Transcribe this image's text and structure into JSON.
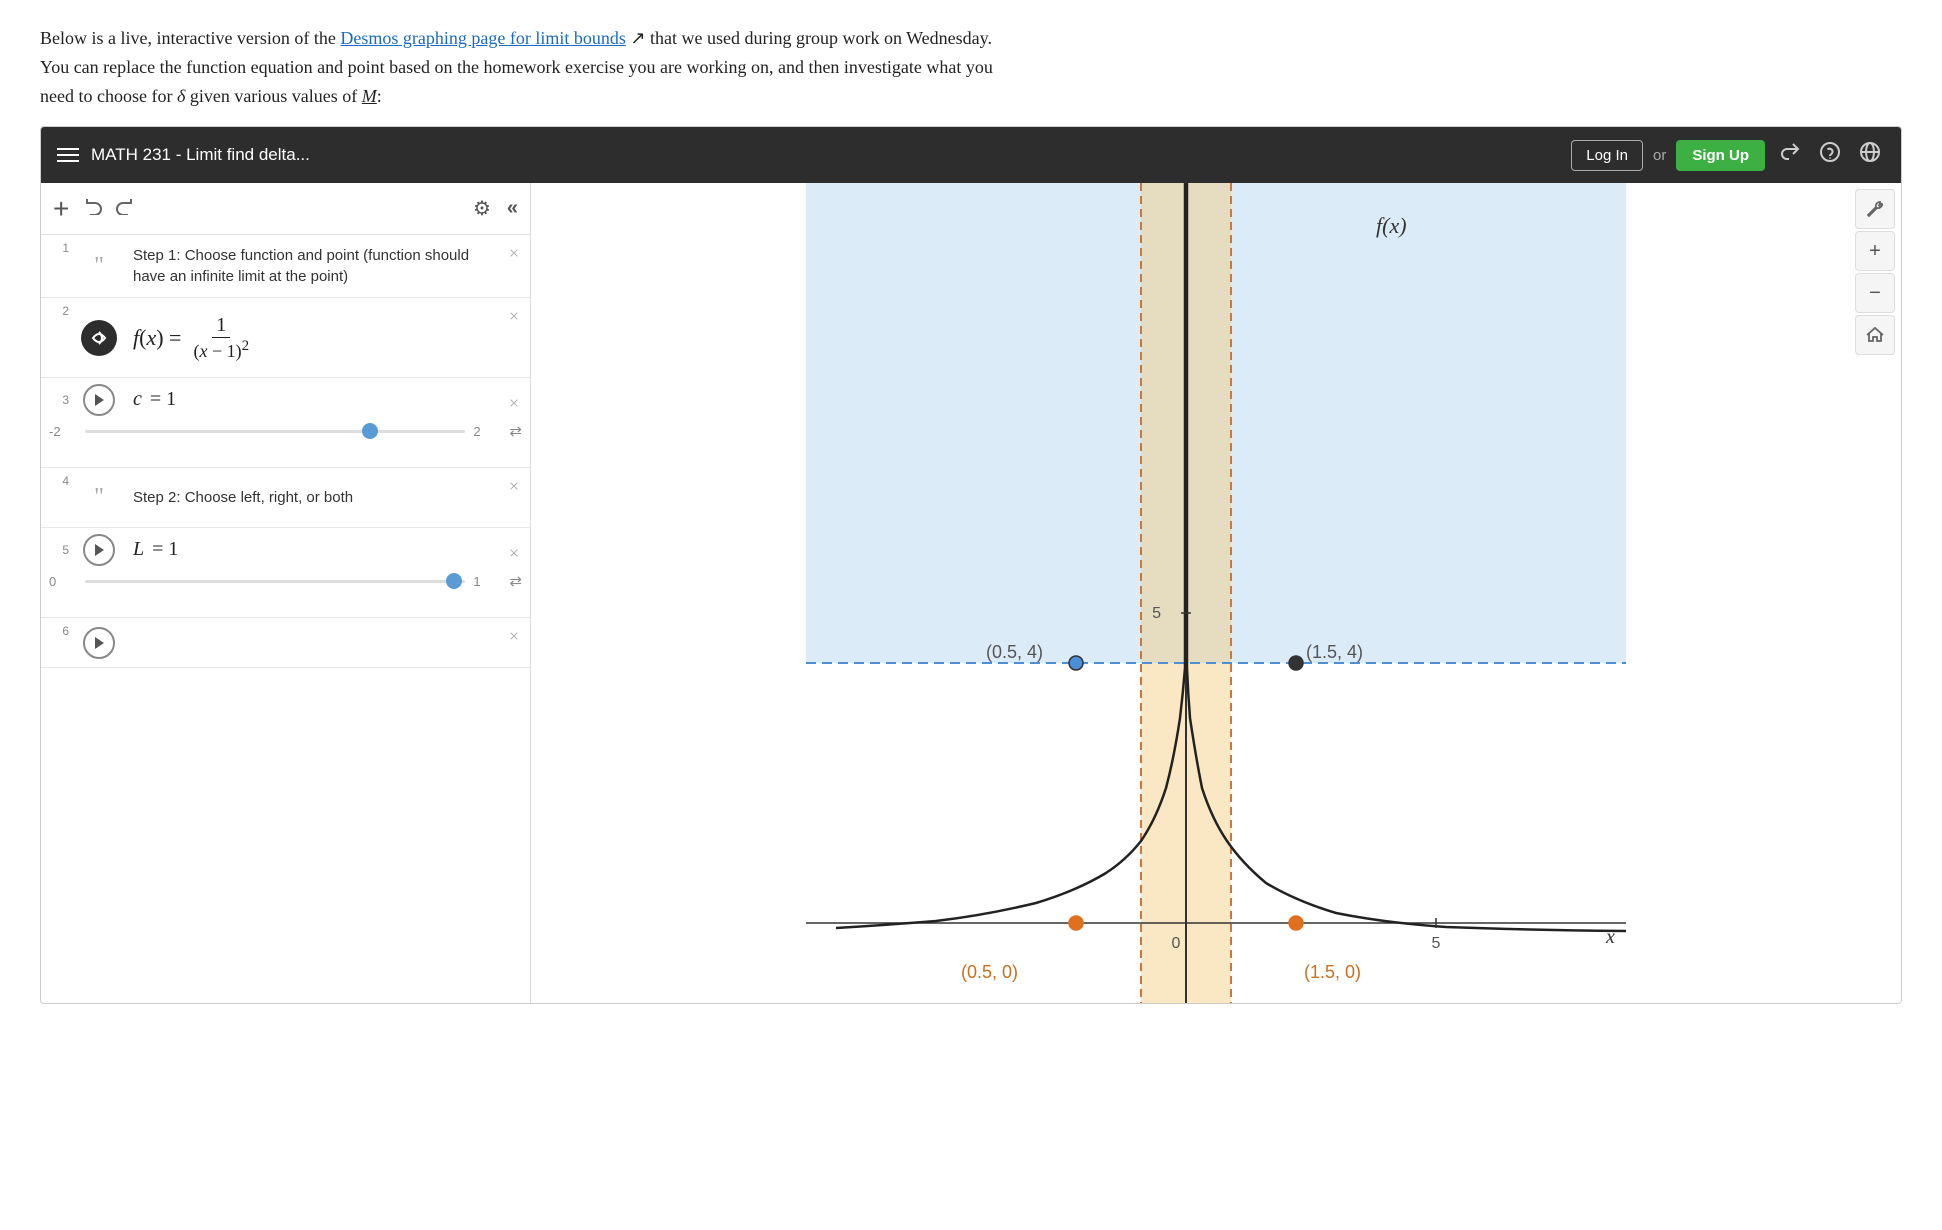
{
  "intro": {
    "line1_start": "Below is a live, interactive version of the ",
    "link_text": "Desmos graphing page for limit bounds",
    "line1_end": " that we used during group work on Wednesday.",
    "line2": "You can replace the function equation and point based on the homework exercise you are working on, and then investigate what you",
    "line3_start": "need to choose for ",
    "delta": "δ",
    "line3_mid": " given various values of ",
    "M": "M",
    "line3_end": ":"
  },
  "header": {
    "title": "MATH 231 - Limit find delta...",
    "login_label": "Log In",
    "or_label": "or",
    "signup_label": "Sign Up"
  },
  "toolbar": {
    "add_label": "+",
    "undo_label": "↩",
    "redo_label": "↪",
    "settings_label": "⚙",
    "collapse_label": "«"
  },
  "expressions": [
    {
      "number": "1",
      "type": "note",
      "text": "Step 1: Choose function and point (function should have an infinite limit at the point)"
    },
    {
      "number": "2",
      "type": "function",
      "formula": "f(x) = 1/(x-1)²"
    },
    {
      "number": "3",
      "type": "slider",
      "var": "c",
      "value": "1",
      "min": "-2",
      "max": "2",
      "thumb_pct": 75
    },
    {
      "number": "4",
      "type": "note",
      "text": "Step 2: Choose left, right, or both"
    },
    {
      "number": "5",
      "type": "slider",
      "var": "L",
      "value": "1",
      "min": "0",
      "max": "1",
      "thumb_pct": 97
    },
    {
      "number": "6",
      "type": "placeholder"
    }
  ],
  "graph": {
    "fx_label": "f(x)",
    "x_label": "x",
    "point1_label": "(0.5, 4)",
    "point2_label": "(1.5, 4)",
    "point3_label": "(0.5, 0)",
    "point4_label": "(1.5, 0)",
    "y_tick_5": "5",
    "x_tick_5": "5",
    "x_tick_0": "0"
  },
  "right_toolbar": {
    "wrench_icon": "🔧",
    "plus_icon": "+",
    "minus_icon": "−",
    "home_icon": "⌂"
  }
}
